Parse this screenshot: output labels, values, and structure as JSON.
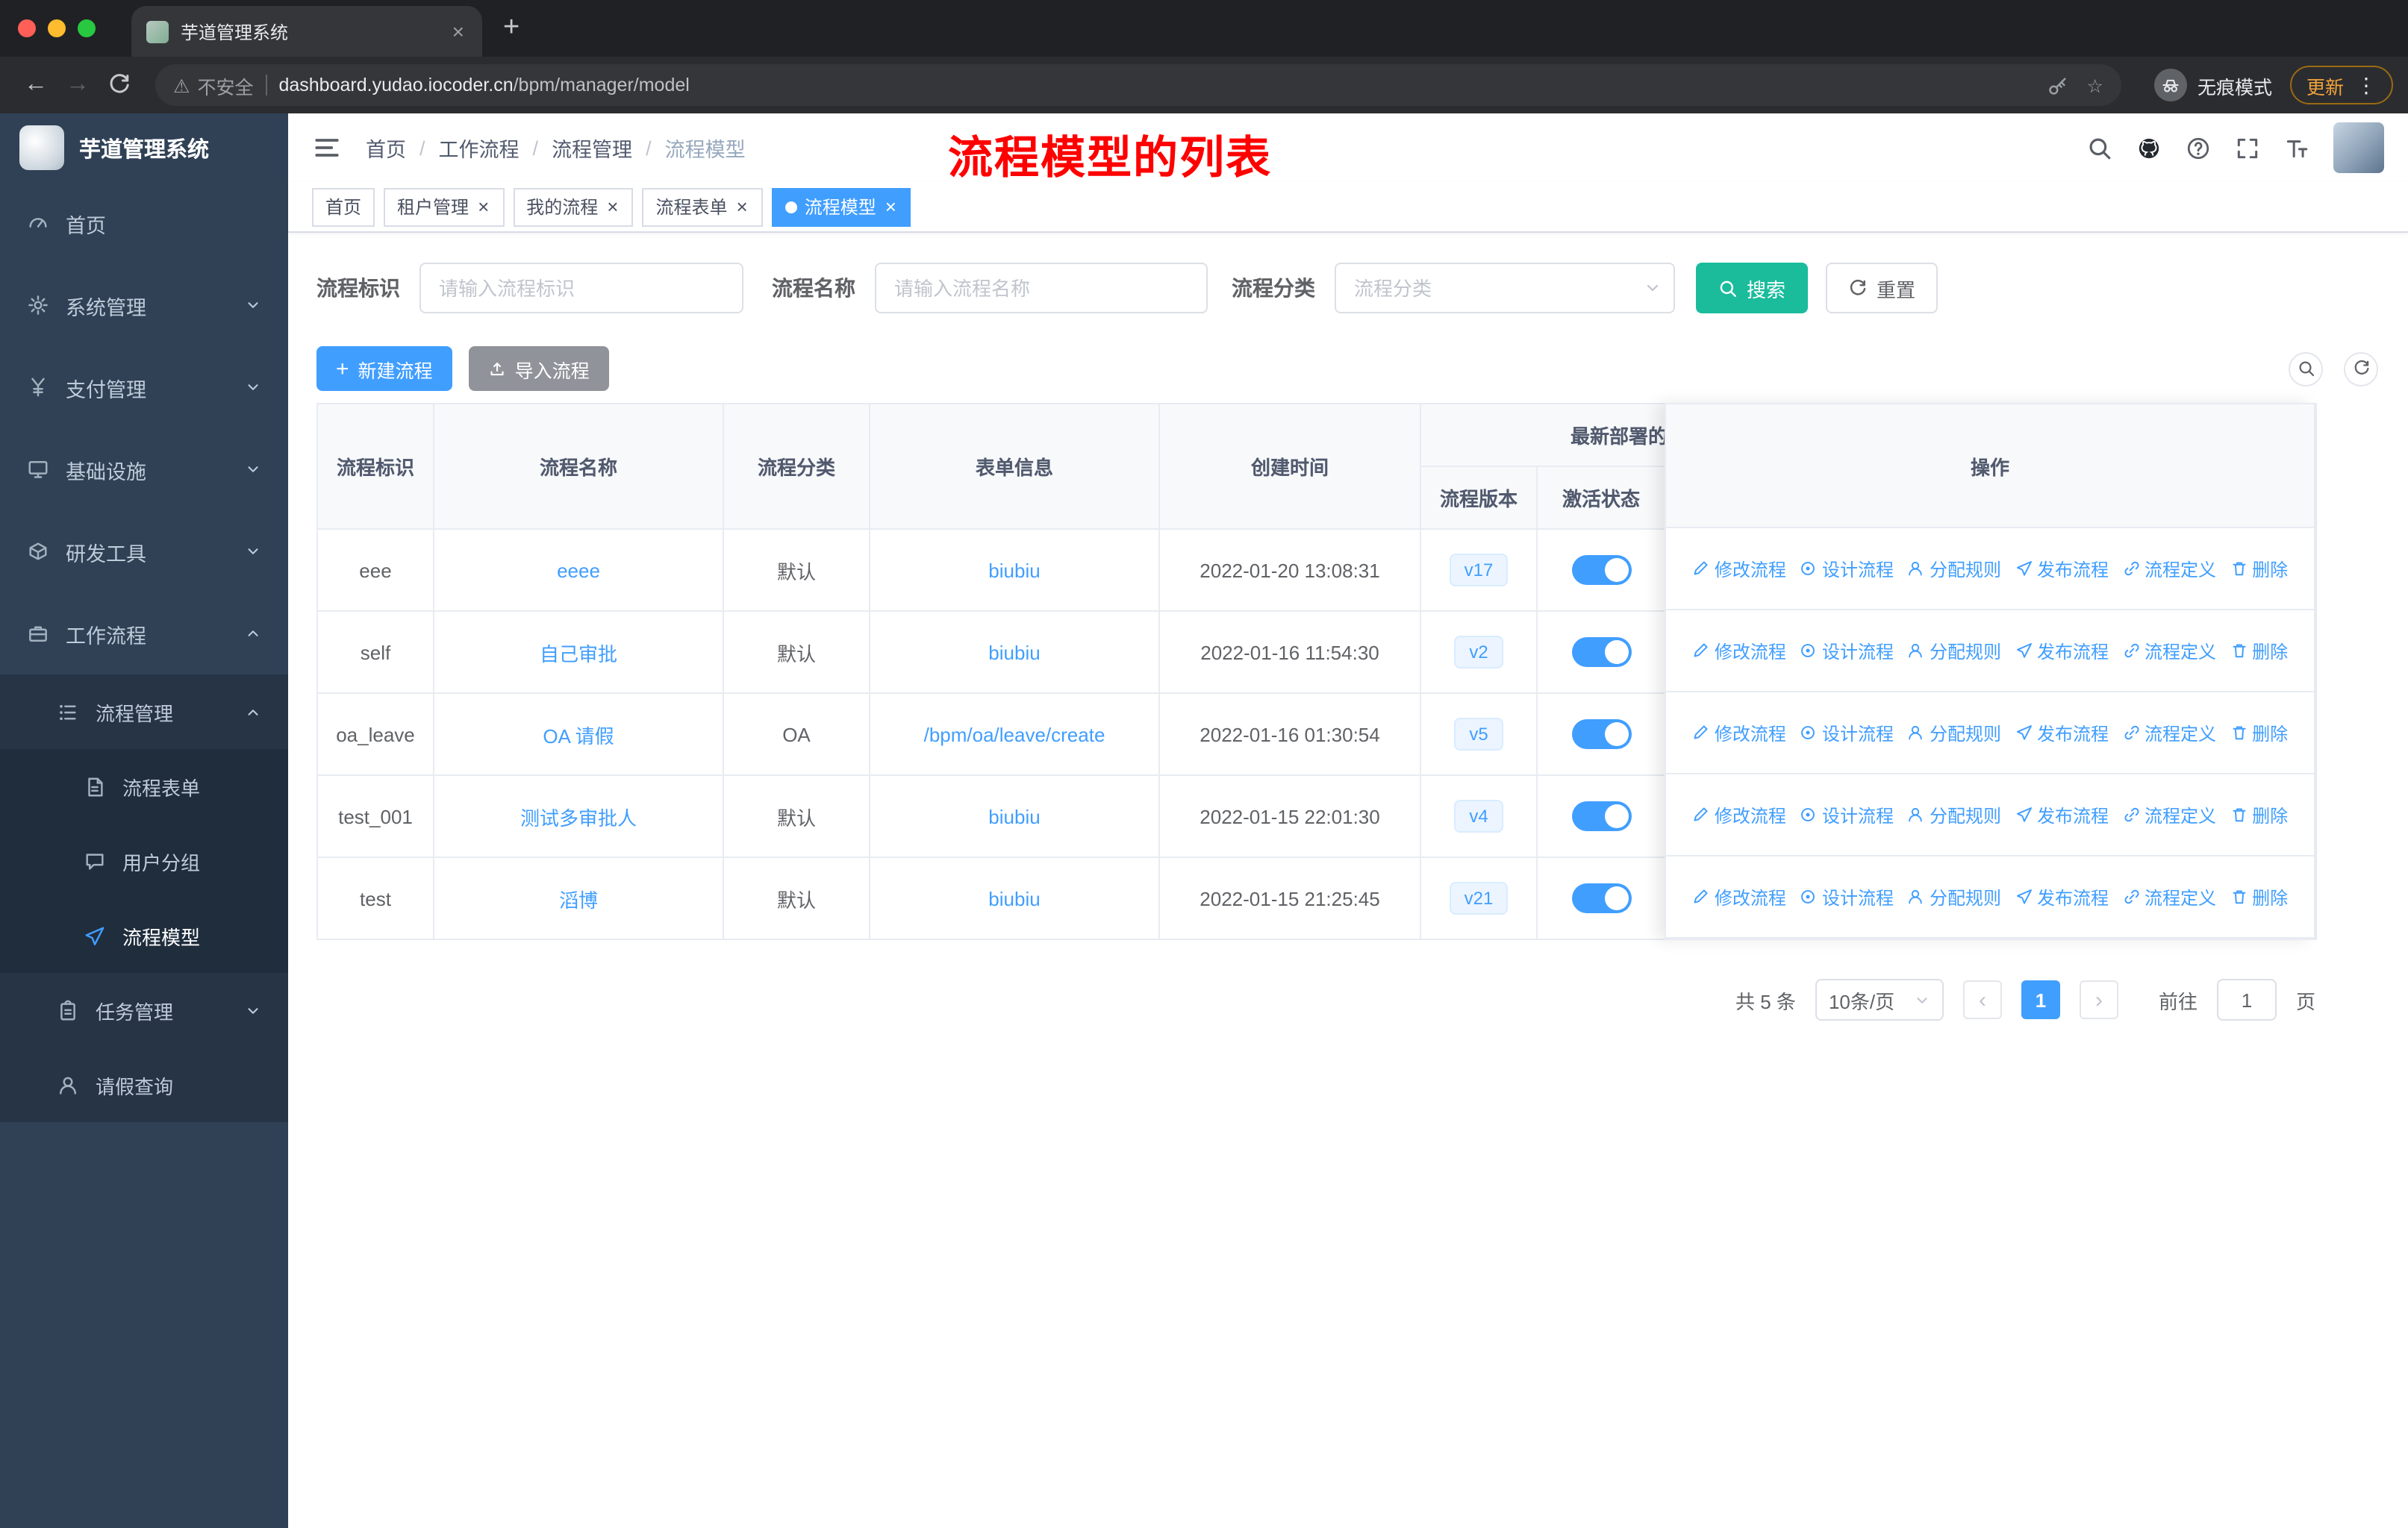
{
  "colors": {
    "accent": "#409eff",
    "search_button": "#1abc9c",
    "annotation_red": "#ff0000",
    "sidebar_bg": "#304156"
  },
  "browser": {
    "tab_title": "芋道管理系统",
    "security_label": "不安全",
    "url_domain": "dashboard.yudao.iocoder.cn",
    "url_path": "/bpm/manager/model",
    "incognito_label": "无痕模式",
    "update_label": "更新"
  },
  "sidebar": {
    "app_title": "芋道管理系统",
    "items": [
      {
        "label": "首页"
      },
      {
        "label": "系统管理"
      },
      {
        "label": "支付管理"
      },
      {
        "label": "基础设施"
      },
      {
        "label": "研发工具"
      },
      {
        "label": "工作流程"
      },
      {
        "label": "流程管理"
      },
      {
        "label": "流程表单"
      },
      {
        "label": "用户分组"
      },
      {
        "label": "流程模型"
      },
      {
        "label": "任务管理"
      },
      {
        "label": "请假查询"
      }
    ]
  },
  "topbar": {
    "breadcrumb": [
      "首页",
      "工作流程",
      "流程管理",
      "流程模型"
    ],
    "annotation": "流程模型的列表"
  },
  "tags": [
    {
      "label": "首页"
    },
    {
      "label": "租户管理"
    },
    {
      "label": "我的流程"
    },
    {
      "label": "流程表单"
    },
    {
      "label": "流程模型"
    }
  ],
  "filter": {
    "id_label": "流程标识",
    "id_placeholder": "请输入流程标识",
    "name_label": "流程名称",
    "name_placeholder": "请输入流程名称",
    "category_label": "流程分类",
    "category_placeholder": "流程分类",
    "search_label": "搜索",
    "reset_label": "重置"
  },
  "toolbar": {
    "create_label": "新建流程",
    "import_label": "导入流程"
  },
  "table": {
    "headers": {
      "id": "流程标识",
      "name": "流程名称",
      "category": "流程分类",
      "form": "表单信息",
      "created": "创建时间",
      "deploy_group": "最新部署的",
      "version": "流程版本",
      "active": "激活状态",
      "ops": "操作"
    },
    "actions": {
      "edit": "修改流程",
      "design": "设计流程",
      "assign": "分配规则",
      "publish": "发布流程",
      "definition": "流程定义",
      "remove": "删除"
    },
    "rows": [
      {
        "id": "eee",
        "name": "eeee",
        "category": "默认",
        "form": "biubiu",
        "created": "2022-01-20 13:08:31",
        "version": "v17"
      },
      {
        "id": "self",
        "name": "自己审批",
        "category": "默认",
        "form": "biubiu",
        "created": "2022-01-16 11:54:30",
        "version": "v2"
      },
      {
        "id": "oa_leave",
        "name": "OA 请假",
        "category": "OA",
        "form": "/bpm/oa/leave/create",
        "created": "2022-01-16 01:30:54",
        "version": "v5"
      },
      {
        "id": "test_001",
        "name": "测试多审批人",
        "category": "默认",
        "form": "biubiu",
        "created": "2022-01-15 22:01:30",
        "version": "v4"
      },
      {
        "id": "test",
        "name": "滔博",
        "category": "默认",
        "form": "biubiu",
        "created": "2022-01-15 21:25:45",
        "version": "v21"
      }
    ]
  },
  "pagination": {
    "total": "共 5 条",
    "page_size": "10条/页",
    "page": "1",
    "goto_label": "前往",
    "page_unit": "页"
  }
}
